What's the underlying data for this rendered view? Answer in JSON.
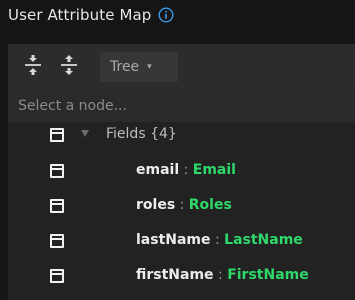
{
  "header": {
    "title": "User Attribute Map",
    "info_icon": "info-circle-icon"
  },
  "toolbar": {
    "collapse_icon": "collapse-all-icon",
    "expand_icon": "expand-all-icon",
    "view_mode": "Tree",
    "view_caret": "▾"
  },
  "search": {
    "placeholder": "Select a node..."
  },
  "tree": {
    "root": {
      "label": "Fields",
      "count": "{4}"
    },
    "separator": ":",
    "fields": [
      {
        "key": "email",
        "value": "Email"
      },
      {
        "key": "roles",
        "value": "Roles"
      },
      {
        "key": "lastName",
        "value": "LastName"
      },
      {
        "key": "firstName",
        "value": "FirstName"
      }
    ]
  },
  "colors": {
    "background": "#151515",
    "panel": "#222222",
    "toolbar": "#2c2c2c",
    "accent_blue": "#3b9be8",
    "value_green": "#2fd86a"
  }
}
